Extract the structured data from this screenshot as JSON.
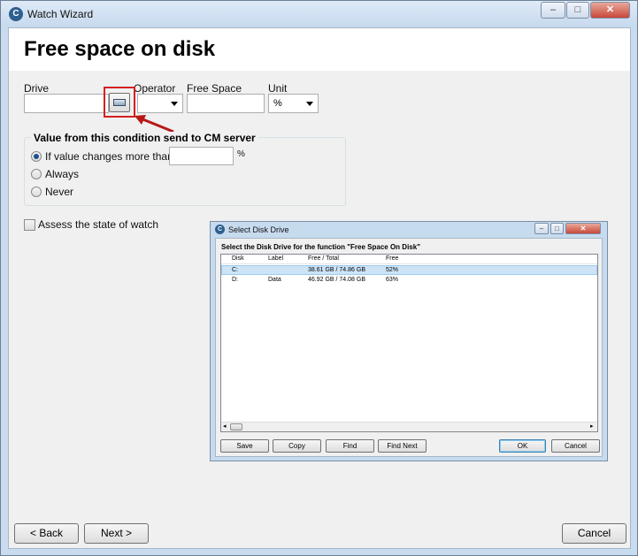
{
  "window": {
    "title": "Watch Wizard",
    "app_icon_glyph": "C",
    "controls": {
      "minimize": "–",
      "maximize": "□",
      "close": "✕"
    }
  },
  "page": {
    "heading": "Free space on disk"
  },
  "fields": {
    "drive_label": "Drive",
    "drive_value": "",
    "operator_label": "Operator",
    "operator_value": "",
    "free_space_label": "Free Space",
    "free_space_value": "",
    "unit_label": "Unit",
    "unit_value": "%"
  },
  "send_group": {
    "title": "Value from this condition send to CM server",
    "options": [
      {
        "label": "If value changes more than",
        "checked": true
      },
      {
        "label": "Always",
        "checked": false
      },
      {
        "label": "Never",
        "checked": false
      }
    ],
    "threshold_value": "",
    "threshold_unit": "%"
  },
  "assess": {
    "label": "Assess the state of watch",
    "checked": false
  },
  "buttons": {
    "back": "< Back",
    "next": "Next >",
    "cancel": "Cancel"
  },
  "colors": {
    "highlight": "#d42020",
    "window_frame": "#c9dcef",
    "selection": "#cde4f7"
  },
  "disk_dialog": {
    "title": "Select Disk Drive",
    "heading": "Select the Disk Drive for the function \"Free Space On Disk\"",
    "columns": [
      "Disk",
      "Label",
      "Free / Total",
      "Free"
    ],
    "rows": [
      {
        "disk": "C:",
        "label": "",
        "free_total": "38.61 GB / 74.86 GB",
        "free": "52%",
        "selected": true
      },
      {
        "disk": "D:",
        "label": "Data",
        "free_total": "46.92 GB / 74.08 GB",
        "free": "63%",
        "selected": false
      }
    ],
    "scroll_left": "◂",
    "scroll_right": "▸",
    "buttons": {
      "save": "Save",
      "copy": "Copy",
      "find": "Find",
      "find_next": "Find Next",
      "ok": "OK",
      "cancel": "Cancel"
    }
  }
}
